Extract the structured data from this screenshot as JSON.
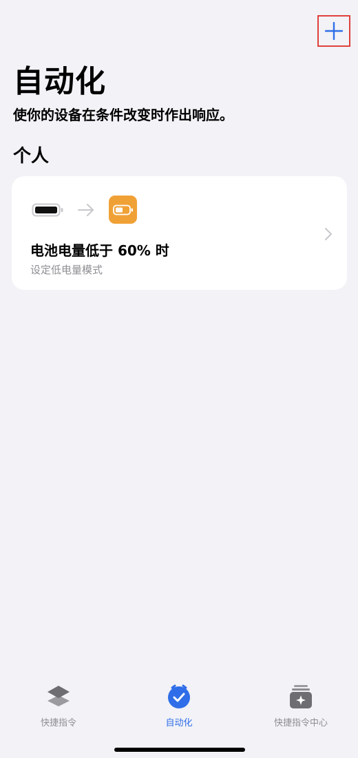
{
  "header": {
    "title": "自动化",
    "subtitle": "使你的设备在条件改变时作出响应。",
    "add_icon": "plus-icon"
  },
  "section": {
    "title": "个人"
  },
  "automation_card": {
    "title": "电池电量低于 60% 时",
    "subtitle": "设定低电量模式",
    "from_icon": "battery-icon",
    "arrow_icon": "arrow-right-icon",
    "action_icon": "battery-low-icon",
    "action_color": "#f0a136"
  },
  "tabbar": {
    "items": [
      {
        "label": "快捷指令",
        "icon": "layers-icon",
        "active": false
      },
      {
        "label": "自动化",
        "icon": "clock-check-icon",
        "active": true
      },
      {
        "label": "快捷指令中心",
        "icon": "gallery-icon",
        "active": false
      }
    ],
    "active_color": "#2f6ee8",
    "inactive_color": "#8e8e93"
  }
}
